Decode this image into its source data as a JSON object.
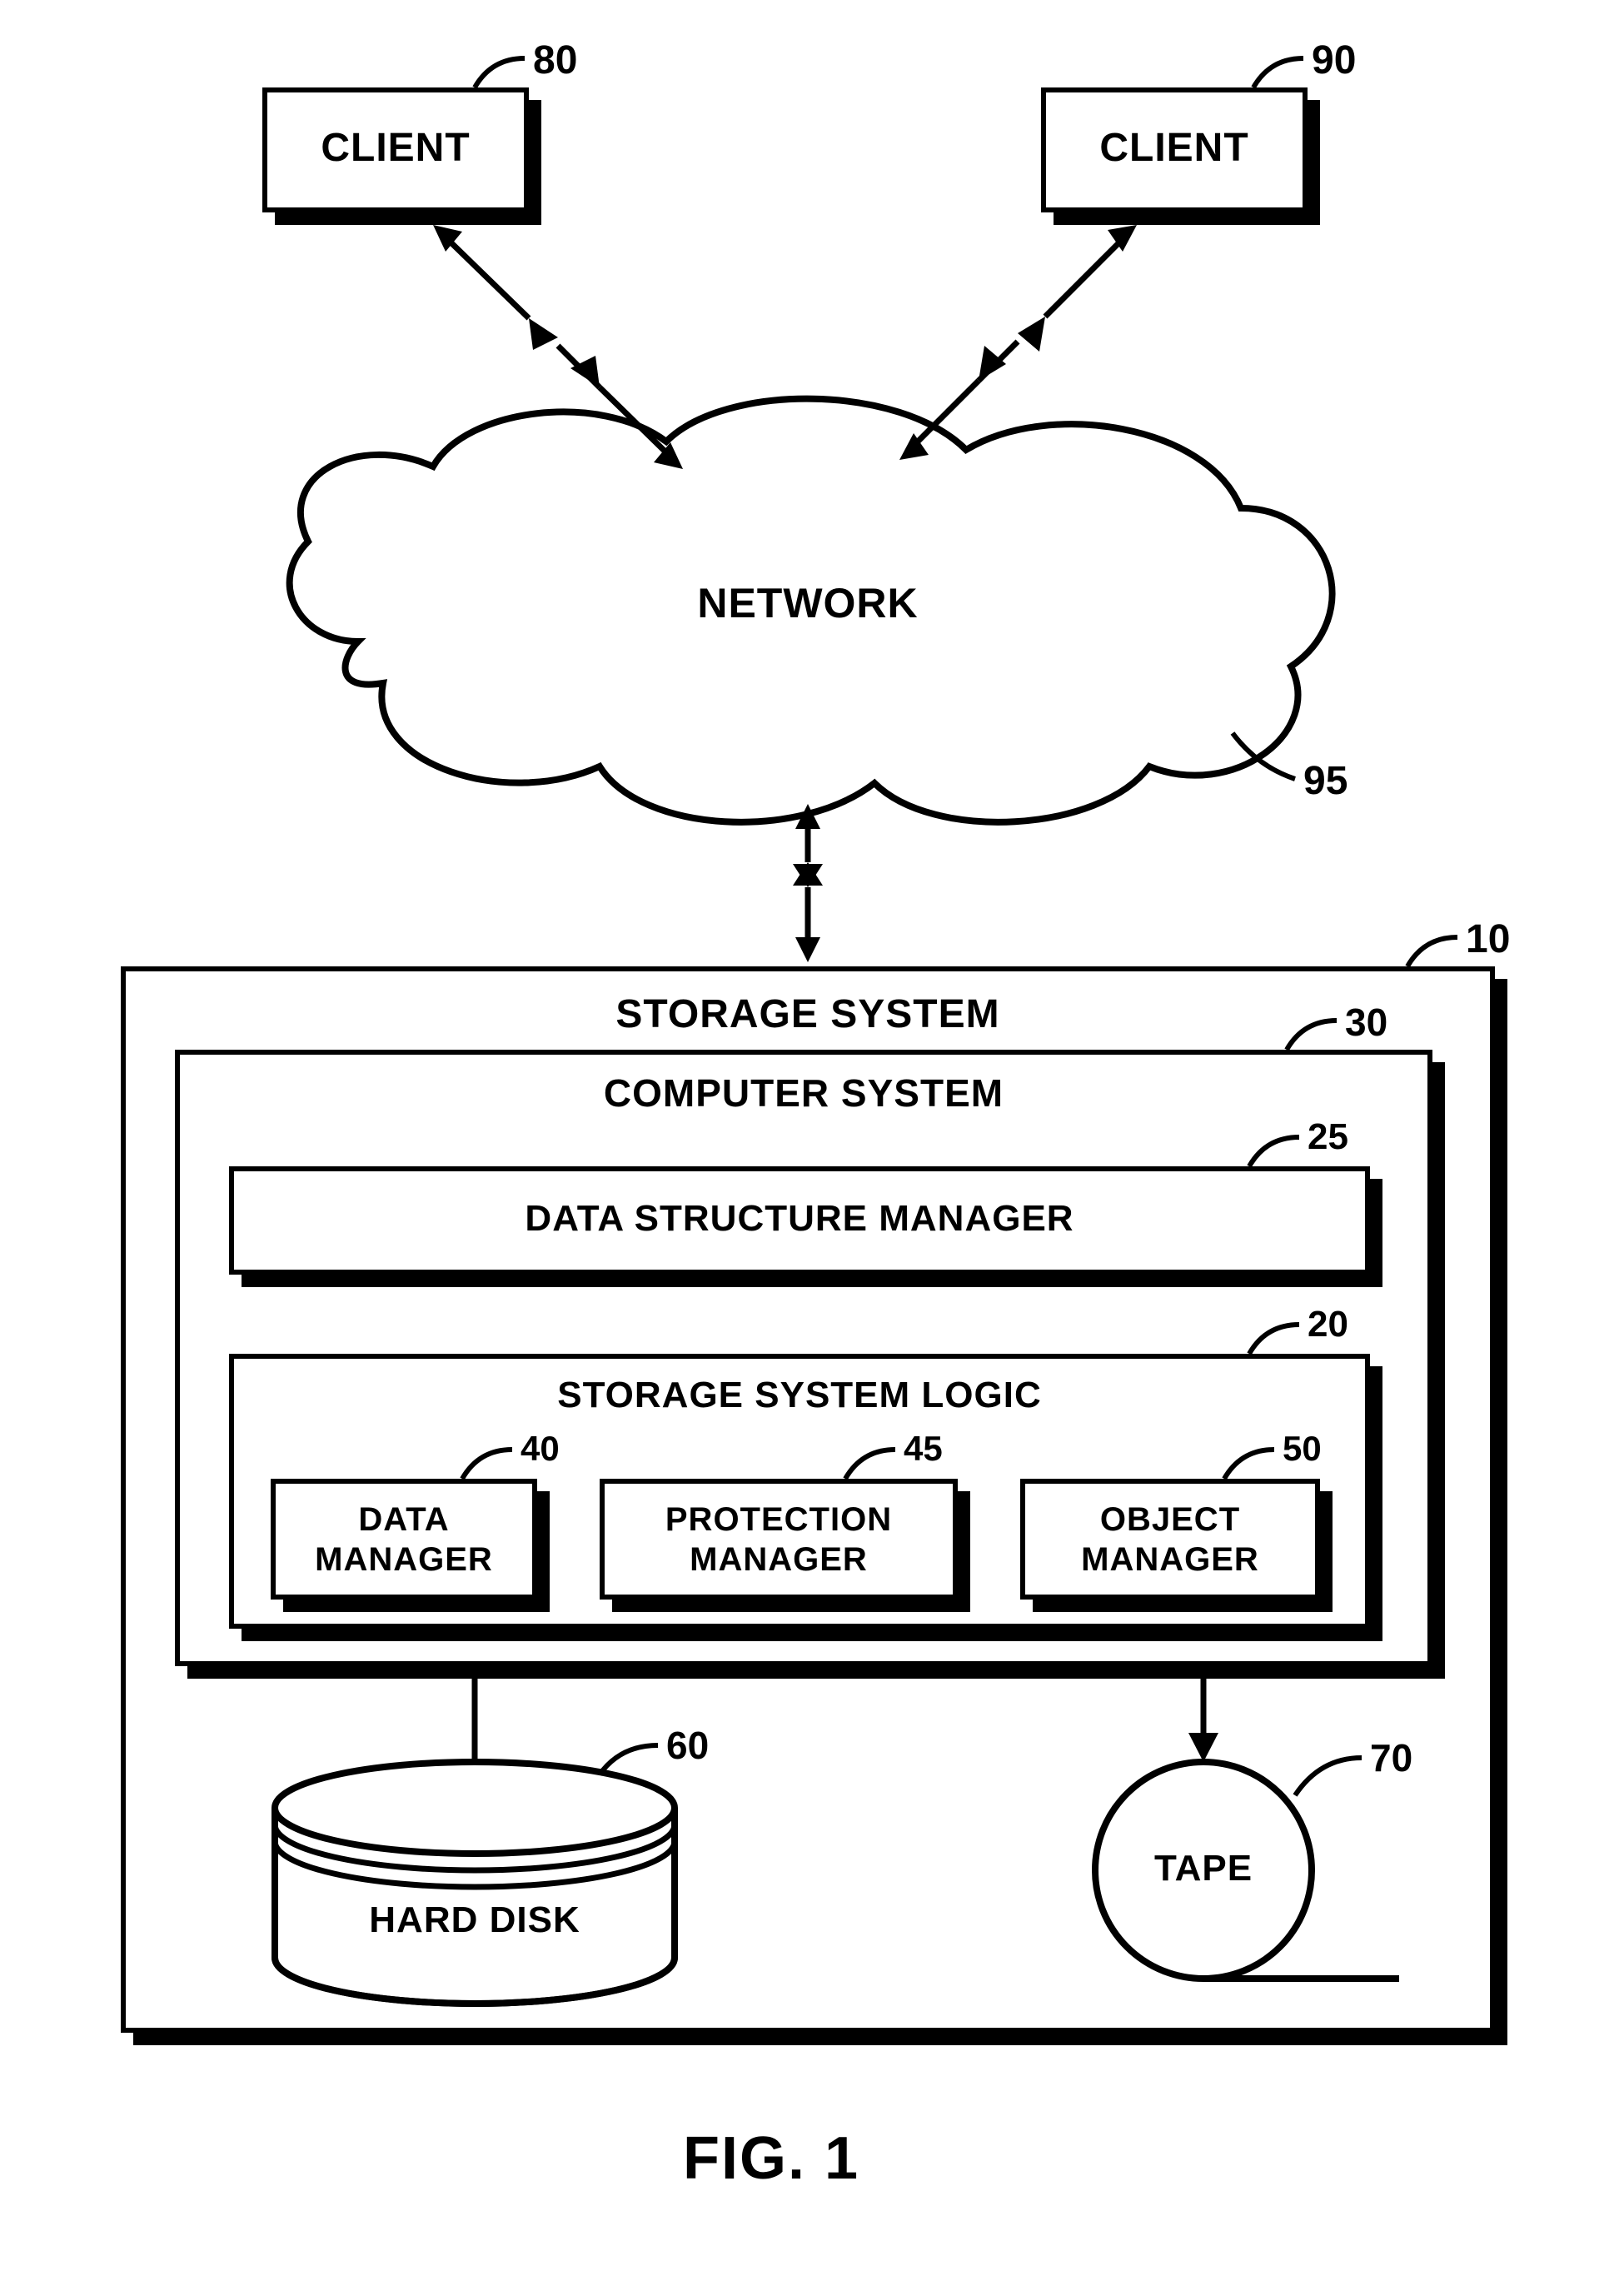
{
  "clients": {
    "left": {
      "label": "CLIENT",
      "ref": "80"
    },
    "right": {
      "label": "CLIENT",
      "ref": "90"
    }
  },
  "network": {
    "label": "NETWORK",
    "ref": "95"
  },
  "storage_system": {
    "label": "STORAGE SYSTEM",
    "ref": "10",
    "computer_system": {
      "label": "COMPUTER SYSTEM",
      "ref": "30",
      "data_structure_manager": {
        "label": "DATA STRUCTURE MANAGER",
        "ref": "25"
      },
      "storage_system_logic": {
        "label": "STORAGE SYSTEM LOGIC",
        "ref": "20",
        "data_manager": {
          "label": "DATA\nMANAGER",
          "ref": "40"
        },
        "protection_manager": {
          "label": "PROTECTION\nMANAGER",
          "ref": "45"
        },
        "object_manager": {
          "label": "OBJECT\nMANAGER",
          "ref": "50"
        }
      }
    },
    "hard_disk": {
      "label": "HARD DISK",
      "ref": "60"
    },
    "tape": {
      "label": "TAPE",
      "ref": "70"
    }
  },
  "figure": "FIG. 1"
}
